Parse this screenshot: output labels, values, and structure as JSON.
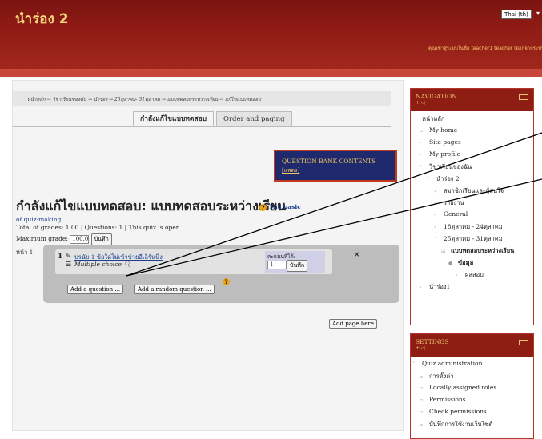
{
  "header": {
    "site_title": "นำร่อง 2",
    "language": "Thai (th)",
    "login_info": "คุณเข้าสู่ระบบในชื่อ teacher1 teacher (ออกจากระบบ)"
  },
  "breadcrumb": "หน้าหลัก → วิชาเรียนของฉัน → นำร่อง → 25ตุลาคม- 31ตุลาคม → แบบทดสอบระหว่างเรียน → แก้ไขแบบทดสอบ",
  "tabs": [
    {
      "label": "กำลังแก้ไขแบบทดสอบ",
      "active": true
    },
    {
      "label": "Order and paging",
      "active": false
    }
  ],
  "question_bank": {
    "title": "QUESTION BANK CONTENTS",
    "toggle": "[แสดง]"
  },
  "quiz": {
    "heading": "กำลังแก้ไขแบบทดสอบ: แบบทดสอบระหว่างเรียน",
    "help_link": "The basic",
    "help_link_cont": "of quiz-making",
    "info": "Total of grades: 1.00 | Questions: 1 | This quiz is open",
    "max_grade_label": "Maximum grade:",
    "max_grade_value": "100.0",
    "save_label": "บันทึก",
    "page_label": "หน้า 1",
    "question": {
      "number": "1",
      "name": "ปรนัย 1  ข้อใดไม่เข้าข่ายอีเลิร์นนิ่ง",
      "type": "Multiple choice",
      "marks_label": "คะแนนที่ได้:",
      "marks_value": "1",
      "save_label": "บันทึก"
    },
    "add_question": "Add a question ...",
    "add_random": "Add a random question ...",
    "add_page": "Add page here"
  },
  "navigation": {
    "title": "NAVIGATION",
    "items": [
      {
        "label": "หน้าหลัก",
        "indent": 0,
        "bullet": ""
      },
      {
        "label": "My home",
        "indent": 1,
        "bullet": "▫"
      },
      {
        "label": "Site pages",
        "indent": 1,
        "bullet": "›"
      },
      {
        "label": "My profile",
        "indent": 1,
        "bullet": "›"
      },
      {
        "label": "วิชาเรียนของฉัน",
        "indent": 1,
        "bullet": "˅"
      },
      {
        "label": "นำร่อง 2",
        "indent": 2,
        "bullet": "˅"
      },
      {
        "label": "สมาชิกเรียนและผู้สนใจ",
        "indent": 3,
        "bullet": "›"
      },
      {
        "label": "รายงาน",
        "indent": 3,
        "bullet": "›"
      },
      {
        "label": "General",
        "indent": 3,
        "bullet": "›"
      },
      {
        "label": "18ตุลาคม - 24ตุลาคม",
        "indent": 3,
        "bullet": "›"
      },
      {
        "label": "25ตุลาคม - 31ตุลาคม",
        "indent": 3,
        "bullet": "˅"
      },
      {
        "label": "แบบทดสอบระหว่างเรียน",
        "indent": 4,
        "bullet": "☑"
      },
      {
        "label": "ข้อมูล",
        "indent": 5,
        "bullet": "●"
      },
      {
        "label": "ผลสอบ",
        "indent": 6,
        "bullet": "›"
      },
      {
        "label": "นำร่อง1",
        "indent": 1,
        "bullet": "›"
      }
    ]
  },
  "settings": {
    "title": "SETTINGS",
    "items": [
      {
        "label": "Quiz administration",
        "indent": 0,
        "bullet": "˅"
      },
      {
        "label": "การตั้งค่า",
        "indent": 1,
        "bullet": "▫"
      },
      {
        "label": "Locally assigned roles",
        "indent": 1,
        "bullet": "▫"
      },
      {
        "label": "Permissions",
        "indent": 1,
        "bullet": "▫"
      },
      {
        "label": "Check permissions",
        "indent": 1,
        "bullet": "▫"
      },
      {
        "label": "บันทึกการใช้งานเว็บไซต์",
        "indent": 1,
        "bullet": "▫"
      }
    ]
  }
}
